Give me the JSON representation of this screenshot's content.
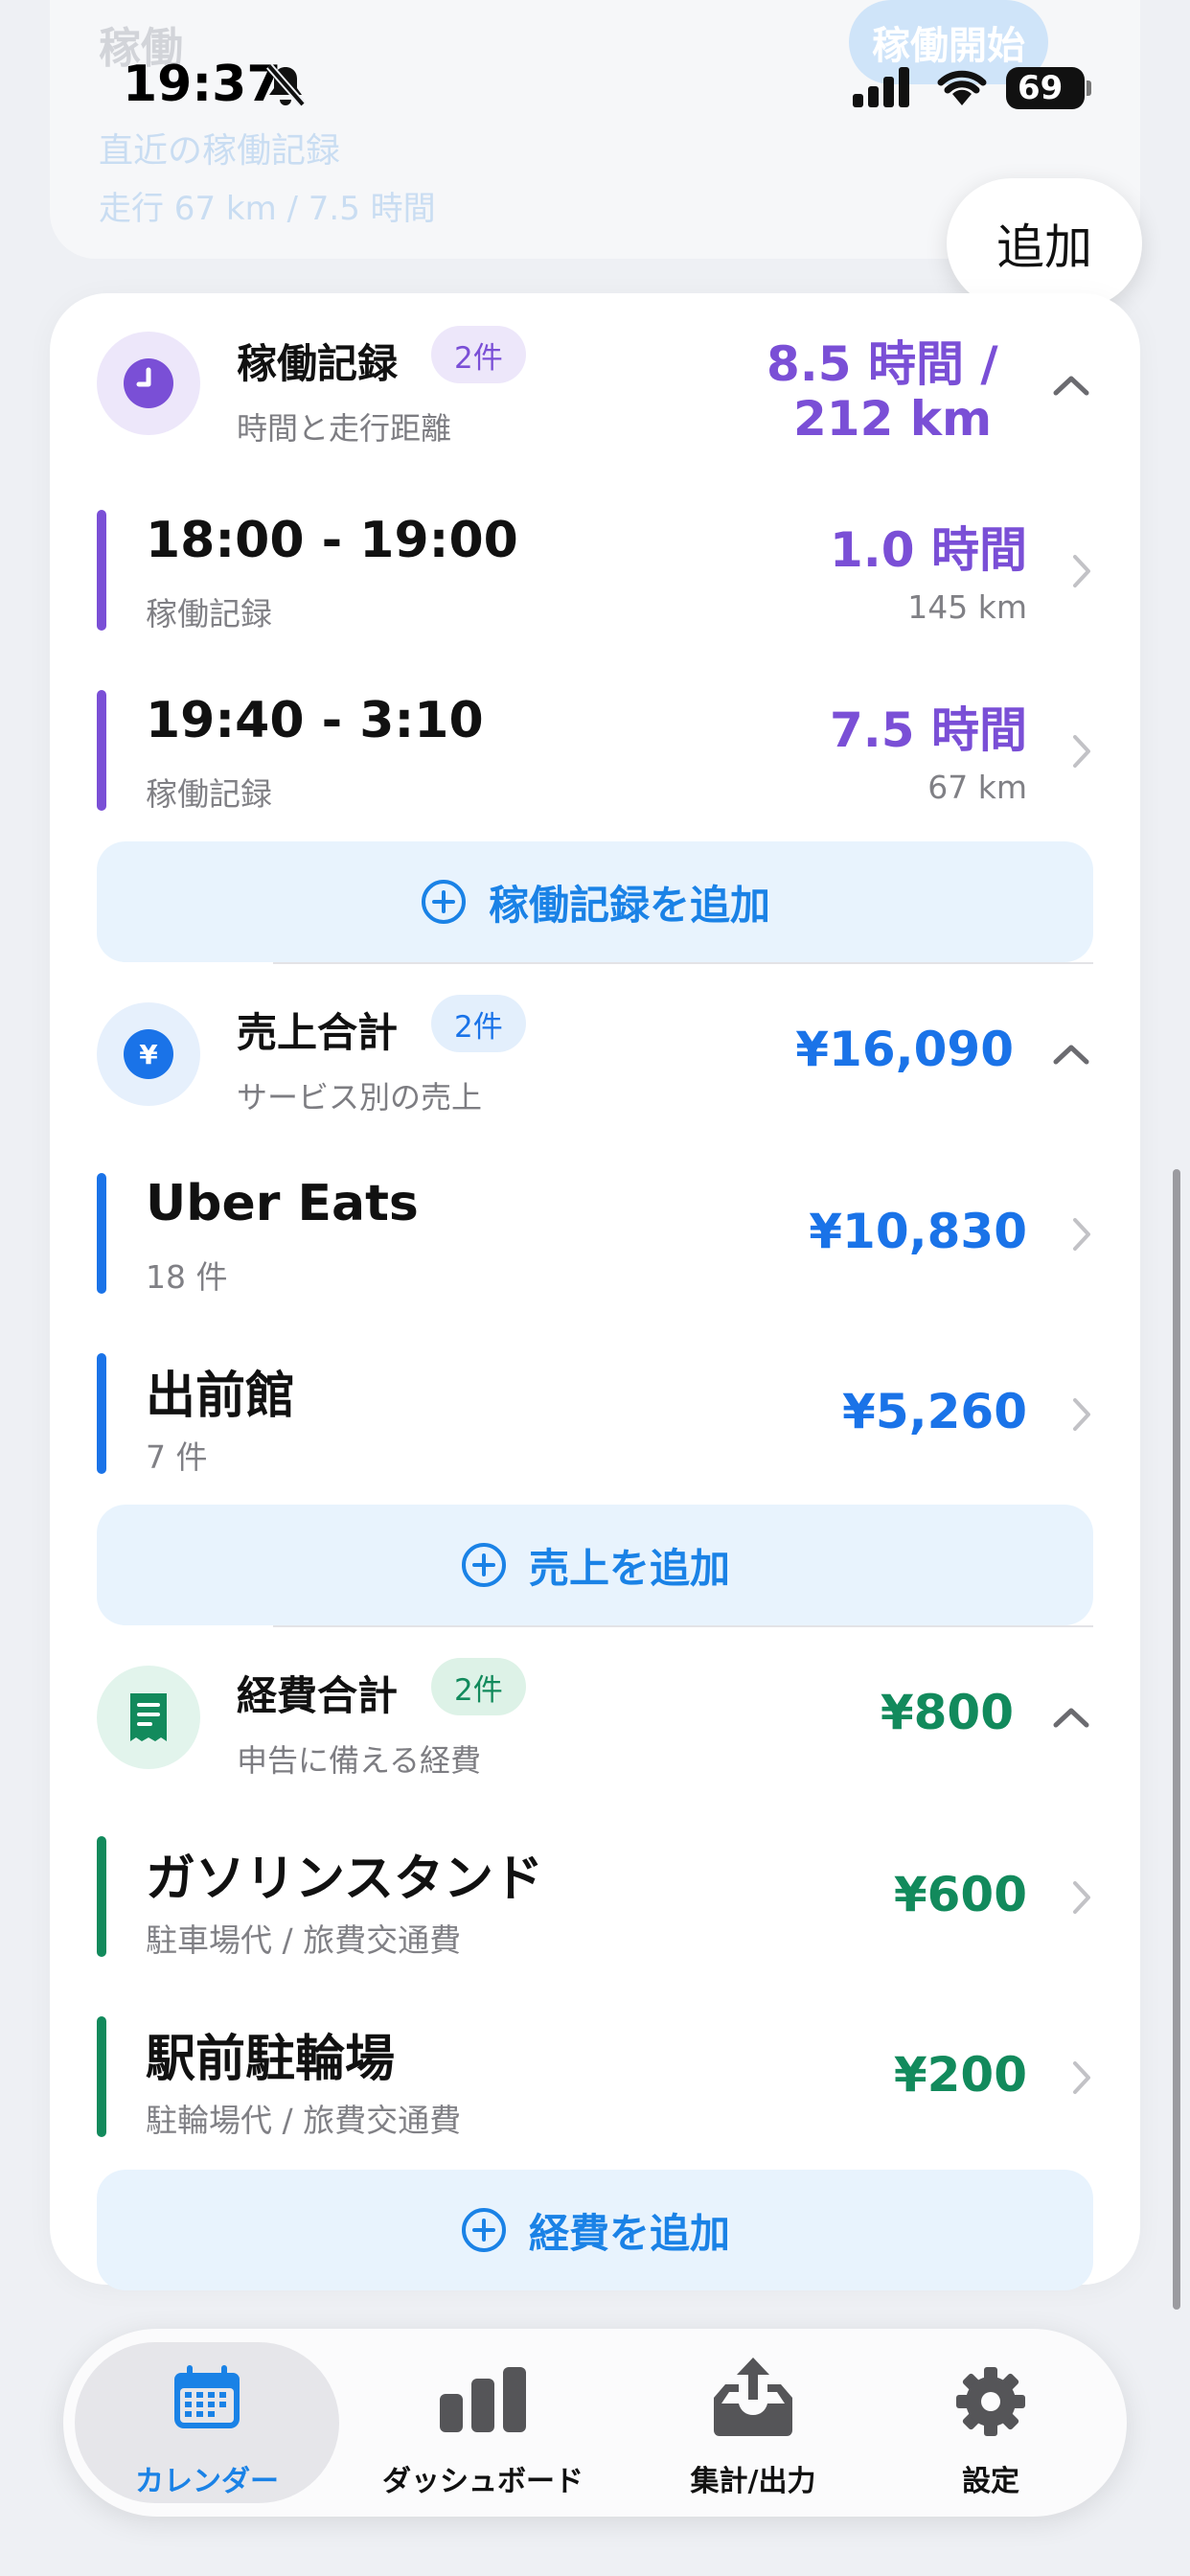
{
  "status_bar": {
    "time": "19:37",
    "battery": "69"
  },
  "background_card": {
    "title": "稼働",
    "start_button": "稼働開始",
    "recent_label": "直近の稼働記録",
    "recent_value": "走行 67 km / 7.5 時間"
  },
  "add_button": "追加",
  "work_section": {
    "title": "稼働記録",
    "badge": "2件",
    "subtitle": "時間と走行距離",
    "total_line1": "8.5 時間 /",
    "total_line2": "212 km",
    "accent_color": "#7a4fd6",
    "rows": [
      {
        "title": "18:00 - 19:00",
        "sub": "稼働記録",
        "value": "1.0 時間",
        "value2": "145 km"
      },
      {
        "title": "19:40 - 3:10",
        "sub": "稼働記録",
        "value": "7.5 時間",
        "value2": "67 km"
      }
    ],
    "add_label": "稼働記録を追加"
  },
  "sales_section": {
    "title": "売上合計",
    "badge": "2件",
    "subtitle": "サービス別の売上",
    "total": "¥16,090",
    "accent_color": "#1a73e8",
    "rows": [
      {
        "title": "Uber Eats",
        "sub": "18 件",
        "value": "¥10,830"
      },
      {
        "title": "出前館",
        "sub": "7 件",
        "value": "¥5,260"
      }
    ],
    "add_label": "売上を追加"
  },
  "expense_section": {
    "title": "経費合計",
    "badge": "2件",
    "subtitle": "申告に備える経費",
    "total": "¥800",
    "accent_color": "#128a5c",
    "rows": [
      {
        "title": "ガソリンスタンド",
        "sub": "駐車場代 / 旅費交通費",
        "value": "¥600"
      },
      {
        "title": "駅前駐輪場",
        "sub": "駐輪場代 / 旅費交通費",
        "value": "¥200"
      }
    ],
    "add_label": "経費を追加"
  },
  "tabbar": {
    "tabs": [
      {
        "label": "カレンダー",
        "icon": "calendar-icon",
        "active": true
      },
      {
        "label": "ダッシュボード",
        "icon": "bar-chart-icon",
        "active": false
      },
      {
        "label": "集計/出力",
        "icon": "export-tray-icon",
        "active": false
      },
      {
        "label": "設定",
        "icon": "gear-icon",
        "active": false
      }
    ]
  }
}
